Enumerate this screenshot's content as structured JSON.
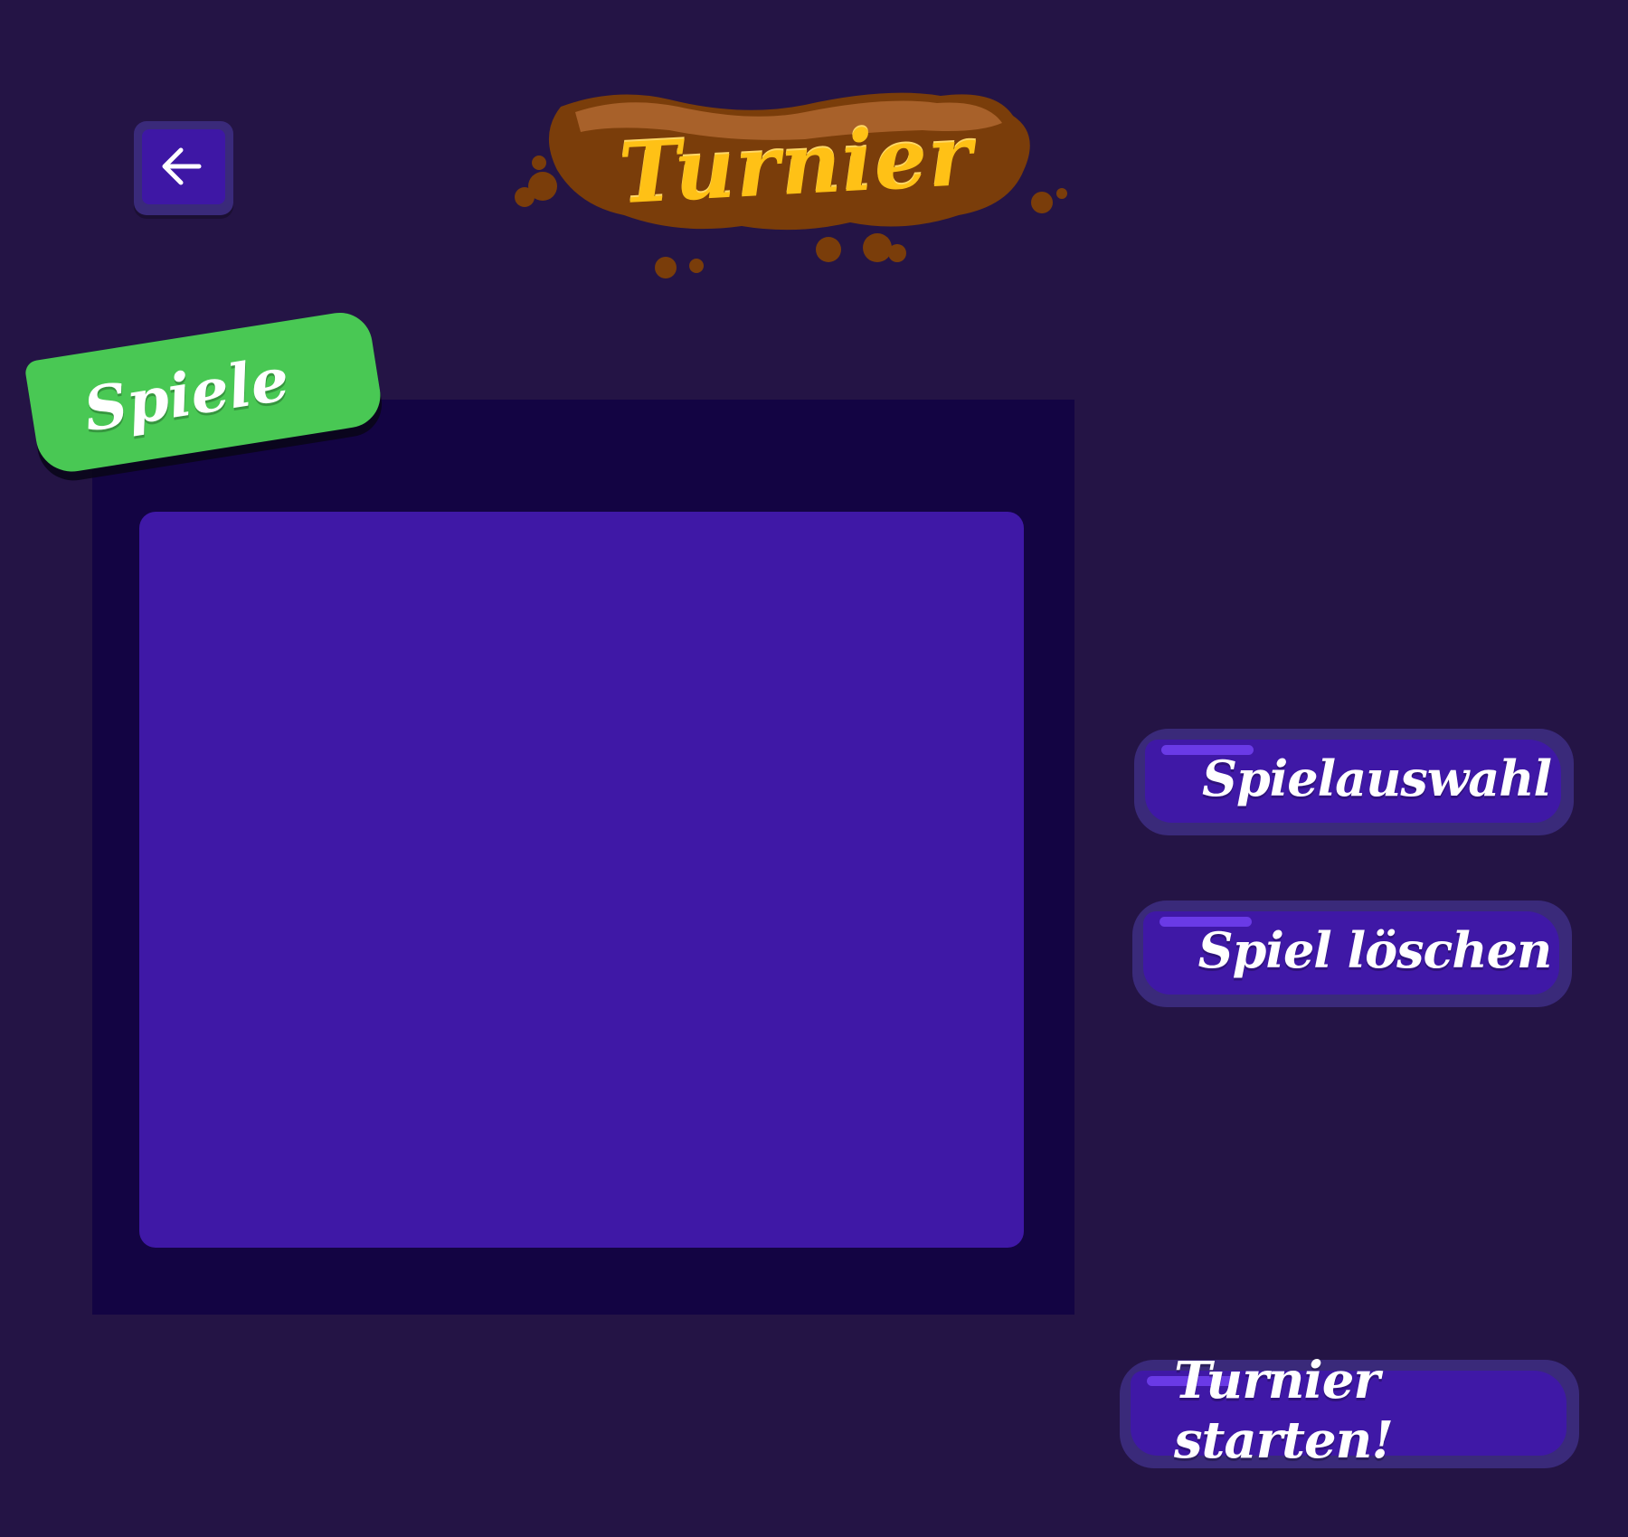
{
  "header": {
    "title": "Turnier",
    "back_icon": "arrow-left-icon"
  },
  "games_section": {
    "tag_label": "Spiele"
  },
  "actions": {
    "select_game_label": "Spielauswahl",
    "delete_game_label": "Spiel löschen",
    "start_tournament_label": "Turnier starten!"
  },
  "colors": {
    "background": "#241445",
    "panel": "#130443",
    "list": "#3f18a6",
    "tag_green": "#49c854",
    "title_yellow": "#ffc116",
    "mud_brown": "#7a3d0a"
  }
}
